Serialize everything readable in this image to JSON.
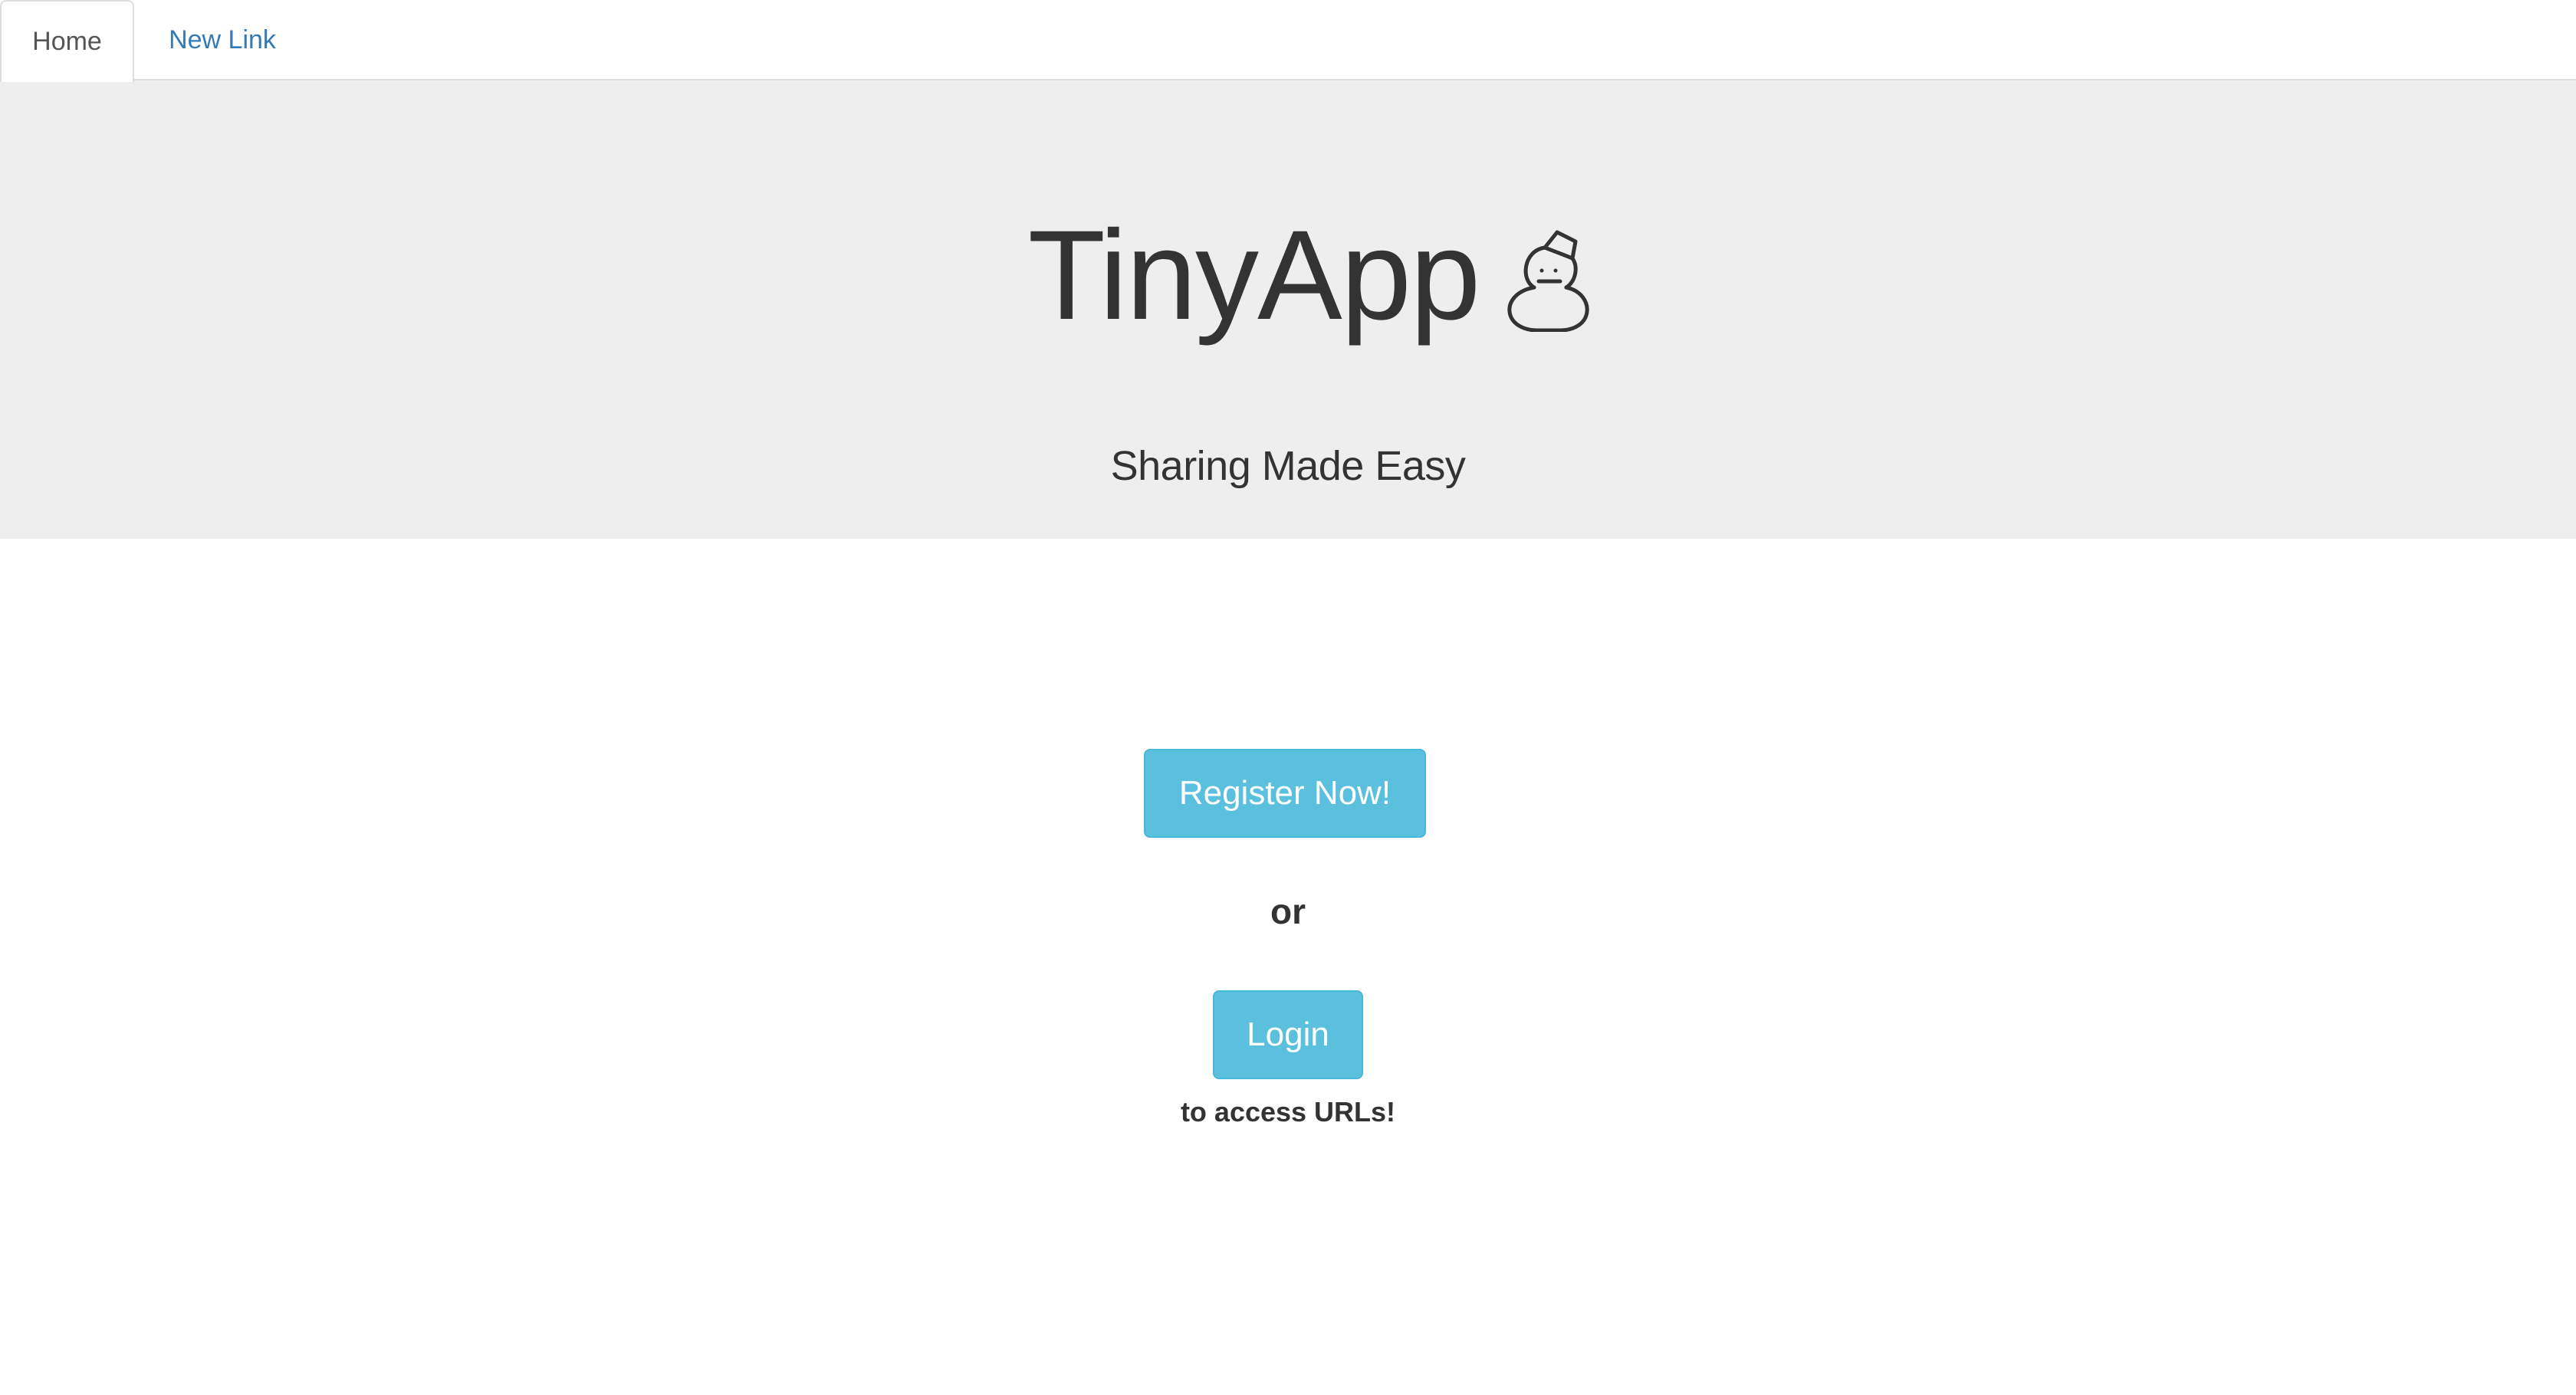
{
  "nav": {
    "tabs": [
      {
        "label": "Home",
        "active": true
      },
      {
        "label": "New Link",
        "active": false
      }
    ],
    "link_color": "#337ab7"
  },
  "hero": {
    "title": "TinyApp",
    "icon": "snowman-icon",
    "tagline": "Sharing Made Easy",
    "background": "#eeeeee"
  },
  "main": {
    "register_label": "Register Now!",
    "or_text": "or",
    "login_label": "Login",
    "access_text": "to access URLs!",
    "button_color": "#5bc0de"
  }
}
